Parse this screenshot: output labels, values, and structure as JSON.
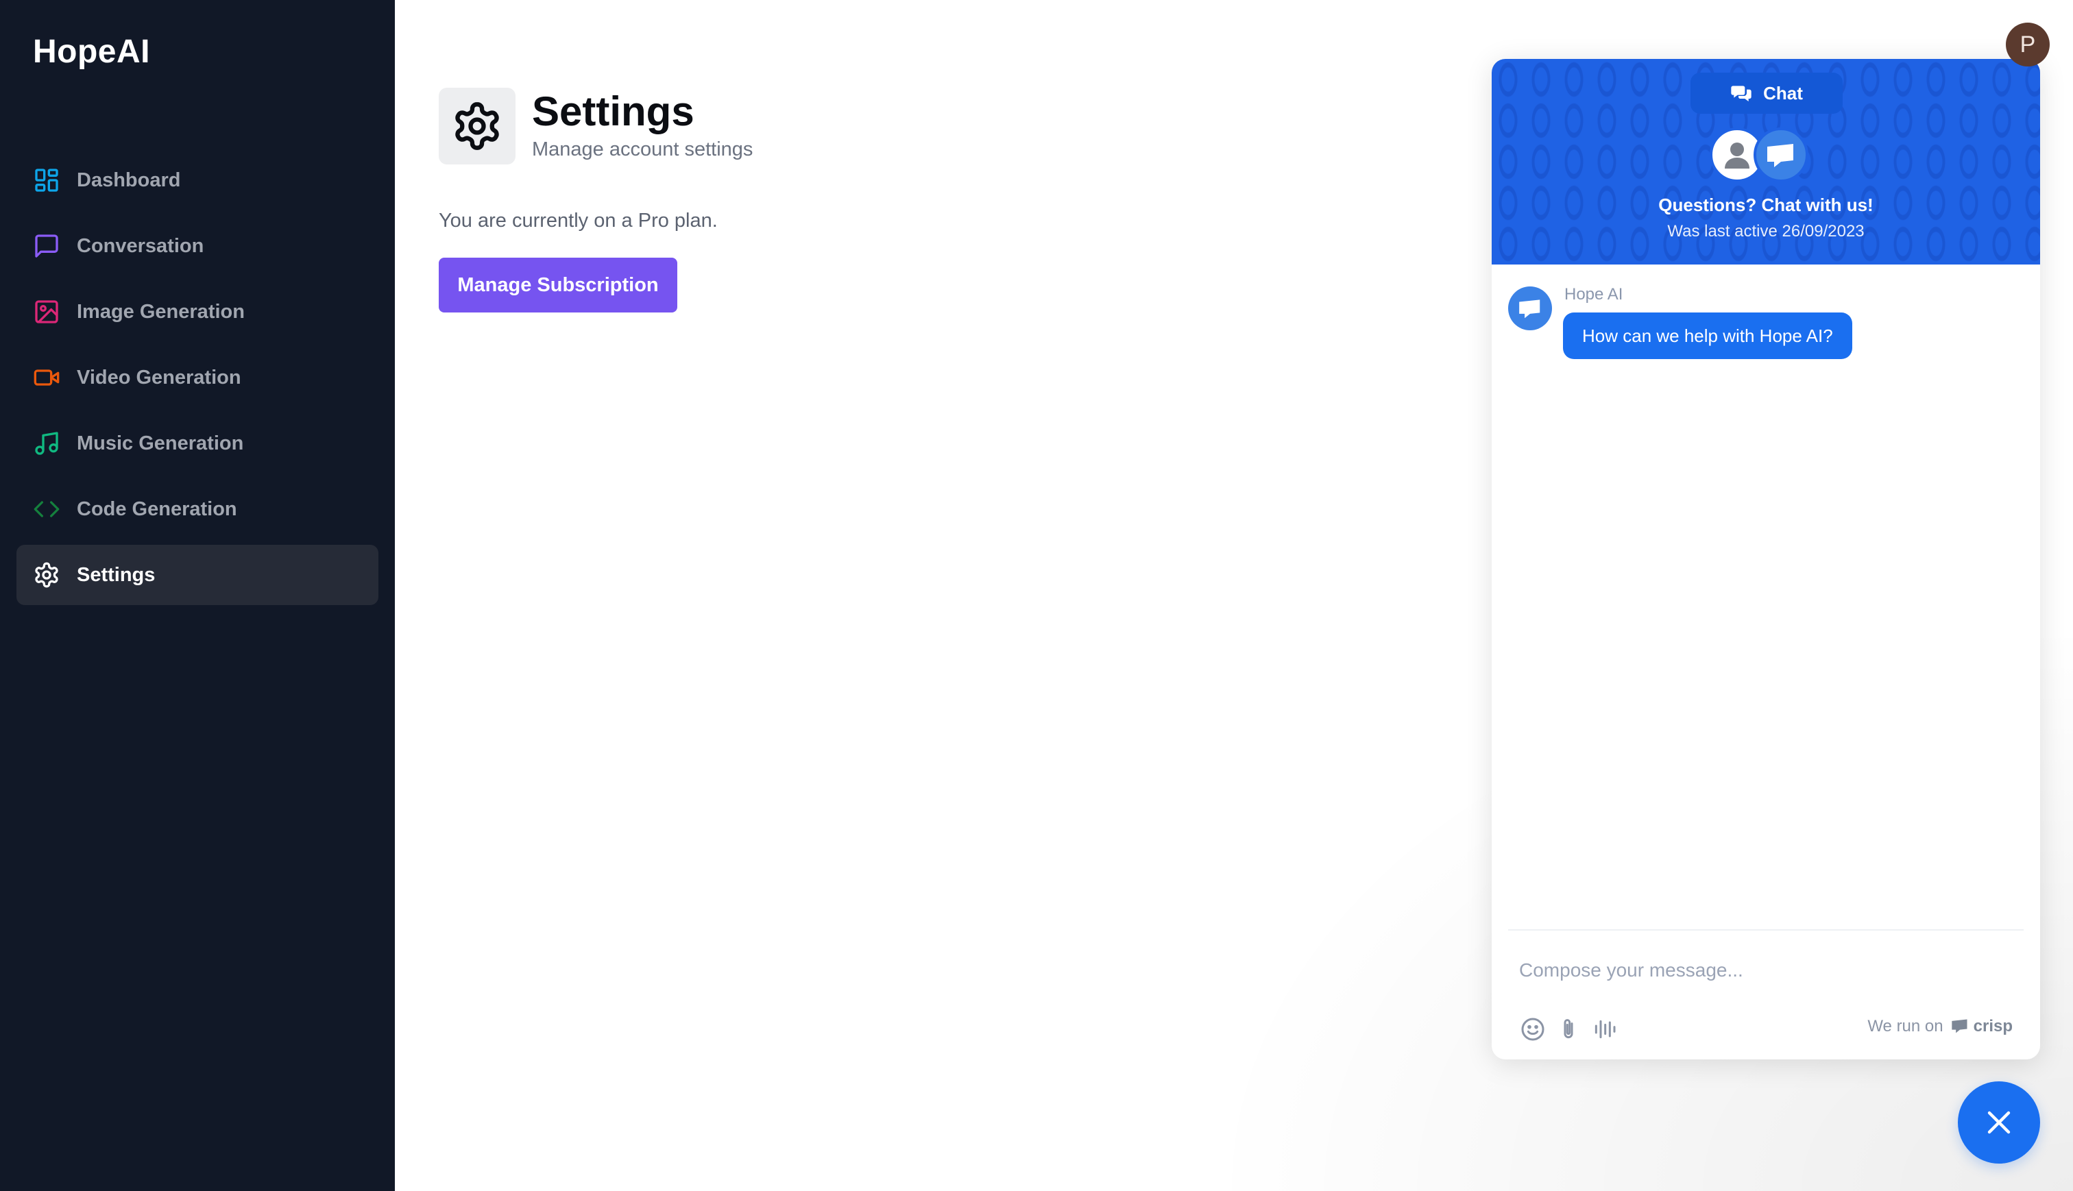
{
  "app": {
    "name": "HopeAI"
  },
  "sidebar": {
    "items": [
      {
        "label": "Dashboard",
        "icon": "dashboard-icon",
        "color": "#0ea5e9"
      },
      {
        "label": "Conversation",
        "icon": "message-square-icon",
        "color": "#8b5cf6"
      },
      {
        "label": "Image Generation",
        "icon": "image-icon",
        "color": "#db2777"
      },
      {
        "label": "Video Generation",
        "icon": "video-icon",
        "color": "#ea580c"
      },
      {
        "label": "Music Generation",
        "icon": "music-icon",
        "color": "#10b981"
      },
      {
        "label": "Code Generation",
        "icon": "code-icon",
        "color": "#15803d"
      },
      {
        "label": "Settings",
        "icon": "settings-icon",
        "color": "#ffffff",
        "active": true
      }
    ]
  },
  "header": {
    "avatar_initial": "P"
  },
  "page": {
    "title": "Settings",
    "subtitle": "Manage account settings",
    "plan_text": "You are currently on a Pro plan.",
    "manage_button": "Manage Subscription",
    "accent": "#7654f0"
  },
  "chat": {
    "tab_label": "Chat",
    "title": "Questions? Chat with us!",
    "subtitle": "Was last active 26/09/2023",
    "message": {
      "sender": "Hope AI",
      "text": "How can we help with Hope AI?"
    },
    "compose_placeholder": "Compose your message...",
    "branding_prefix": "We run on",
    "branding_name": "crisp",
    "accent": "#1a6ff0"
  }
}
